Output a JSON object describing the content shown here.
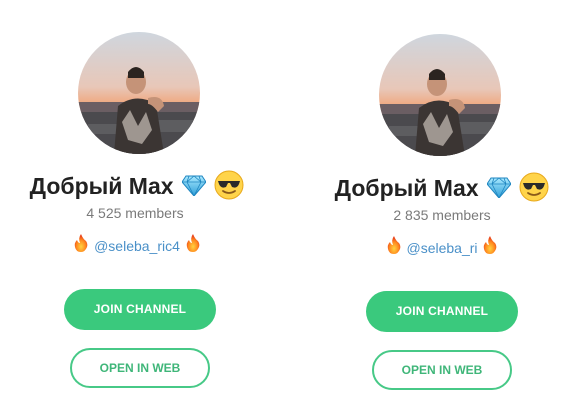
{
  "colors": {
    "join_bg": "#3ac97d",
    "web_border": "#47c987",
    "handle": "#4a90c8",
    "members": "#7a7a7a",
    "name": "#222222"
  },
  "cards": [
    {
      "avatar_icon": "person-photo-avatar",
      "name": "Добрый Max",
      "name_emojis": [
        "diamond-icon",
        "sunglasses-face-icon"
      ],
      "members": "4 525 members",
      "handle": "@seleba_ric4",
      "handle_icons": [
        "fire-icon",
        "fire-icon"
      ],
      "join_label": "JOIN CHANNEL",
      "web_label": "OPEN IN WEB"
    },
    {
      "avatar_icon": "person-photo-avatar",
      "name": "Добрый Max",
      "name_emojis": [
        "diamond-icon",
        "sunglasses-face-icon"
      ],
      "members": "2 835 members",
      "handle": "@seleba_ri",
      "handle_icons": [
        "fire-icon",
        "fire-icon"
      ],
      "join_label": "JOIN CHANNEL",
      "web_label": "OPEN IN WEB"
    }
  ]
}
